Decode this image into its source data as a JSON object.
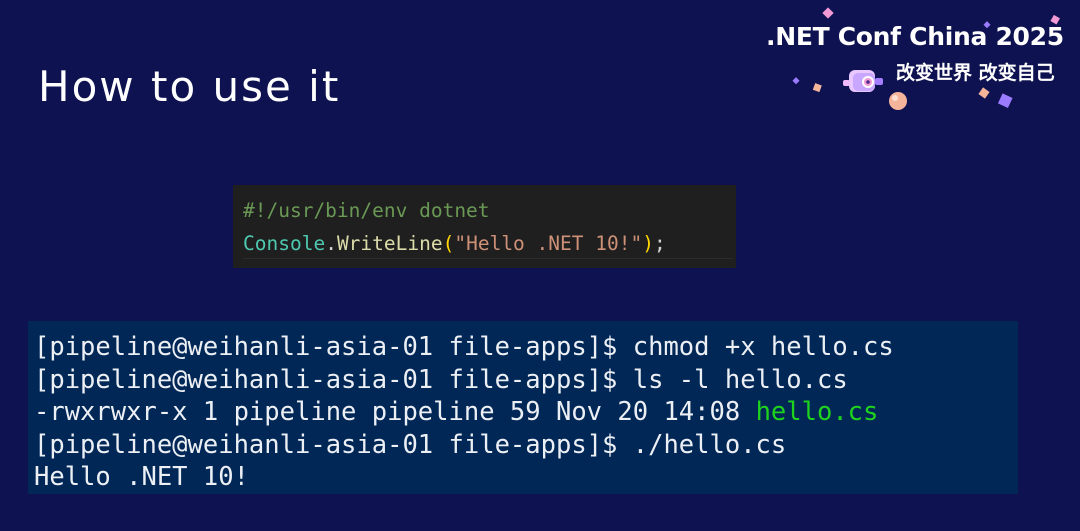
{
  "slide": {
    "title": "How to use it"
  },
  "brand": {
    "title": ".NET Conf China 2025",
    "subtitle": "改变世界 改变自己",
    "colors": {
      "background": "#0e1250",
      "accent_pink": "#f29ad6",
      "accent_purple": "#9b7bff",
      "accent_peach": "#f4b59a"
    }
  },
  "editor": {
    "line1": "#!/usr/bin/env dotnet",
    "line2": {
      "type": "Console",
      "dot": ".",
      "method": "WriteLine",
      "paren_open": "(",
      "string": "\"Hello .NET 10!\"",
      "paren_close": ")",
      "semicolon": ";"
    }
  },
  "terminal": {
    "lines": [
      "[pipeline@weihanli-asia-01 file-apps]$ chmod +x hello.cs",
      "[pipeline@weihanli-asia-01 file-apps]$ ls -l hello.cs"
    ],
    "ls_output_prefix": "-rwxrwxr-x 1 pipeline pipeline 59 Nov 20 14:08 ",
    "ls_output_file": "hello.cs",
    "run_line": "[pipeline@weihanli-asia-01 file-apps]$ ./hello.cs",
    "output": "Hello .NET 10!"
  }
}
